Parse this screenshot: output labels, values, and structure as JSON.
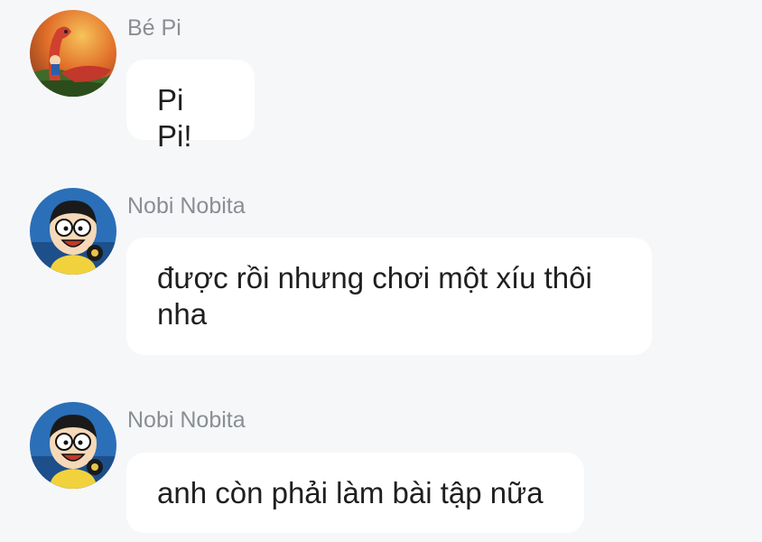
{
  "messages": [
    {
      "sender": "Bé Pi",
      "avatar": "pi-dinosaur-avatar",
      "text": "Pi Pi!"
    },
    {
      "sender": "Nobi Nobita",
      "avatar": "nobita-avatar",
      "text": "được rồi nhưng chơi một xíu thôi nha"
    },
    {
      "sender": "Nobi Nobita",
      "avatar": "nobita-avatar",
      "text": "anh còn phải làm bài tập nữa"
    }
  ],
  "colors": {
    "background": "#f6f7f9",
    "bubble": "#ffffff",
    "sender_name": "#8a8e94",
    "message_text": "#1f1f1f"
  }
}
